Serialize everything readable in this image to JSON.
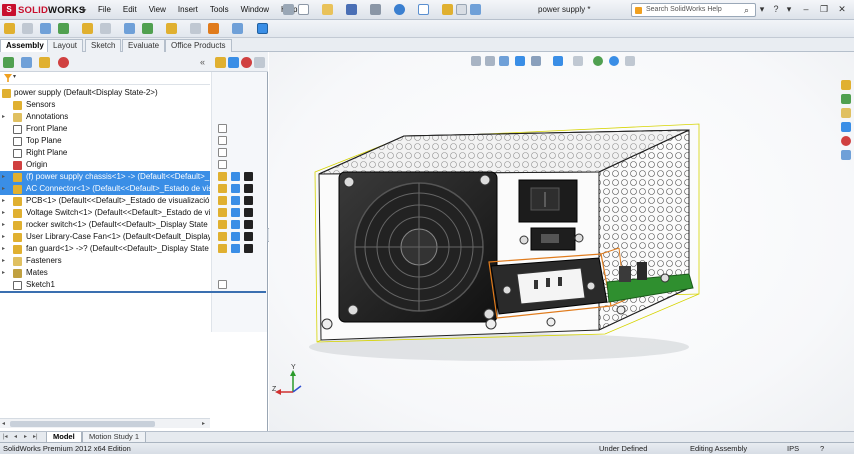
{
  "app": {
    "logo_prefix": "S",
    "logo_brand": "SOLID",
    "logo_suffix": "WORKS",
    "document_title": "power supply *"
  },
  "menu": {
    "items": [
      "File",
      "Edit",
      "View",
      "Insert",
      "Tools",
      "Window",
      "Help"
    ]
  },
  "search": {
    "placeholder": "Search SolidWorks Help"
  },
  "command_tabs": [
    "Assembly",
    "Layout",
    "Sketch",
    "Evaluate",
    "Office Products"
  ],
  "tree": {
    "root": "power supply  (Default<Display State-2>)",
    "items": [
      {
        "label": "Sensors",
        "icon": "sensor-icon",
        "expandable": false,
        "selected": false
      },
      {
        "label": "Annotations",
        "icon": "annotation-icon",
        "expandable": true,
        "selected": false
      },
      {
        "label": "Front Plane",
        "icon": "plane-icon",
        "expandable": false,
        "selected": false
      },
      {
        "label": "Top Plane",
        "icon": "plane-icon",
        "expandable": false,
        "selected": false
      },
      {
        "label": "Right Plane",
        "icon": "plane-icon",
        "expandable": false,
        "selected": false
      },
      {
        "label": "Origin",
        "icon": "origin-icon",
        "expandable": false,
        "selected": false
      },
      {
        "label": "(f) power supply chassis<1> -> (Default<<Default>_",
        "icon": "part-icon",
        "expandable": true,
        "selected": true
      },
      {
        "label": "AC Connector<1> (Default<<Default>_Estado de vis",
        "icon": "part-icon",
        "expandable": true,
        "selected": true
      },
      {
        "label": "PCB<1> (Default<<Default>_Estado de visualización",
        "icon": "part-icon",
        "expandable": true,
        "selected": false
      },
      {
        "label": "Voltage Switch<1> (Default<<Default>_Estado de vi",
        "icon": "part-icon",
        "expandable": true,
        "selected": false
      },
      {
        "label": "rocker switch<1> (Default<<Default>_Display State",
        "icon": "part-icon",
        "expandable": true,
        "selected": false
      },
      {
        "label": "User Library-Case Fan<1> (Default<Default_Display",
        "icon": "part-icon",
        "expandable": true,
        "selected": false
      },
      {
        "label": "fan guard<1> ->? (Default<<Default>_Display State",
        "icon": "part-icon",
        "expandable": true,
        "selected": false
      },
      {
        "label": "Fasteners",
        "icon": "folder-icon",
        "expandable": true,
        "selected": false
      },
      {
        "label": "Mates",
        "icon": "mates-icon",
        "expandable": true,
        "selected": false
      },
      {
        "label": "Sketch1",
        "icon": "sketch-icon",
        "expandable": false,
        "selected": false
      }
    ]
  },
  "bottom_tabs": [
    "Model",
    "Motion Study 1"
  ],
  "status": {
    "product": "SolidWorks Premium 2012 x64 Edition",
    "state": "Under Defined",
    "mode": "Editing Assembly",
    "units": "IPS",
    "help": "?"
  },
  "colors": {
    "selection": "#3a8ee6",
    "brand_red": "#c8102e",
    "pcb_green": "#2f8f2f",
    "bbox_yellow": "#d6d400",
    "highlight_orange": "#e07b1c"
  }
}
